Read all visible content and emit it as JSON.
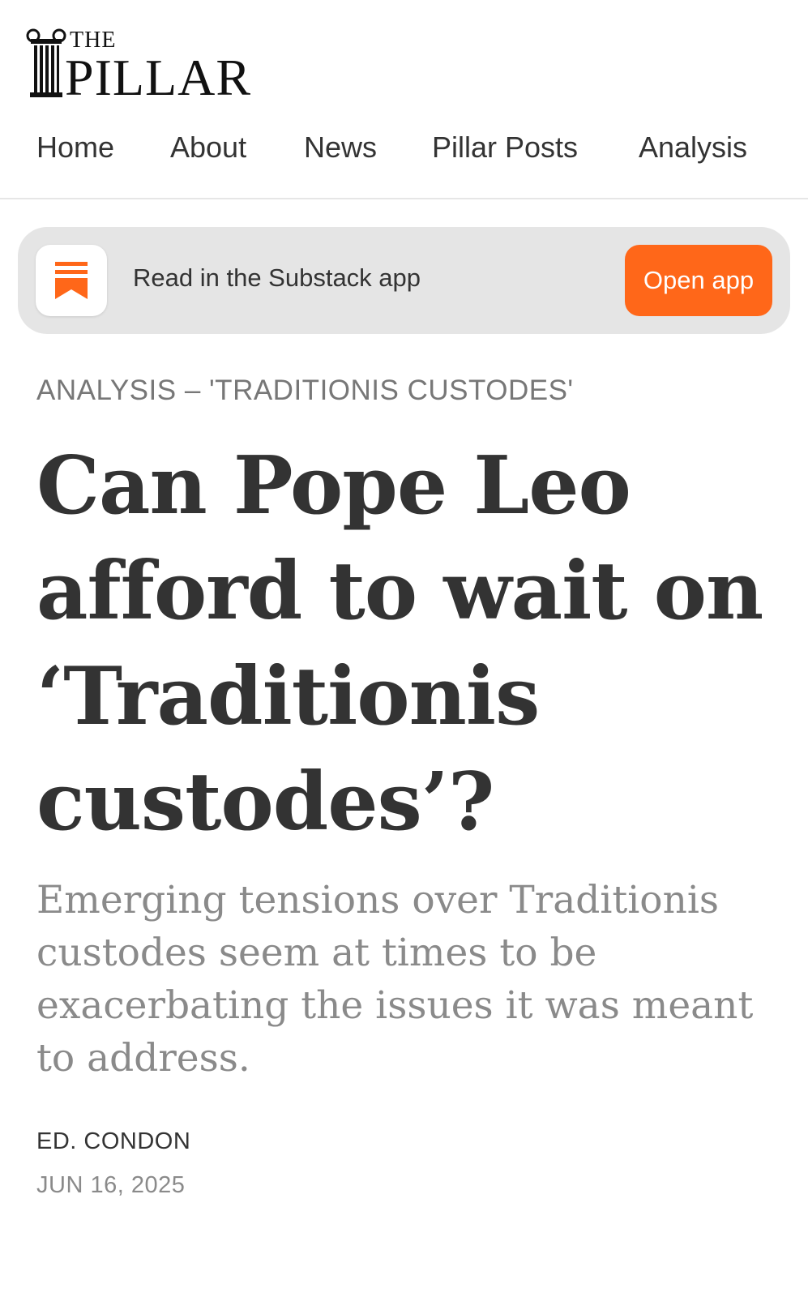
{
  "header": {
    "logo": {
      "word_the": "THE",
      "word_pillar": "PILLAR"
    },
    "nav": [
      {
        "label": "Home"
      },
      {
        "label": "About"
      },
      {
        "label": "News"
      },
      {
        "label": "Pillar Posts"
      },
      {
        "label": "Analysis"
      }
    ]
  },
  "banner": {
    "icon": "substack-bookmark-icon",
    "text": "Read in the Substack app",
    "button_label": "Open app",
    "accent_color": "#ff6719"
  },
  "article": {
    "kicker": "ANALYSIS – 'TRADITIONIS CUSTODES'",
    "title": "Can Pope Leo afford to wait on ‘Traditionis custodes’?",
    "subtitle": "Emerging tensions over Traditionis custodes seem at times to be exacerbating the issues it was meant to address.",
    "author": "ED. CONDON",
    "date": "JUN 16, 2025"
  },
  "colors": {
    "text": "#333333",
    "muted": "#8a8a8a",
    "banner_bg": "#e5e5e5"
  }
}
